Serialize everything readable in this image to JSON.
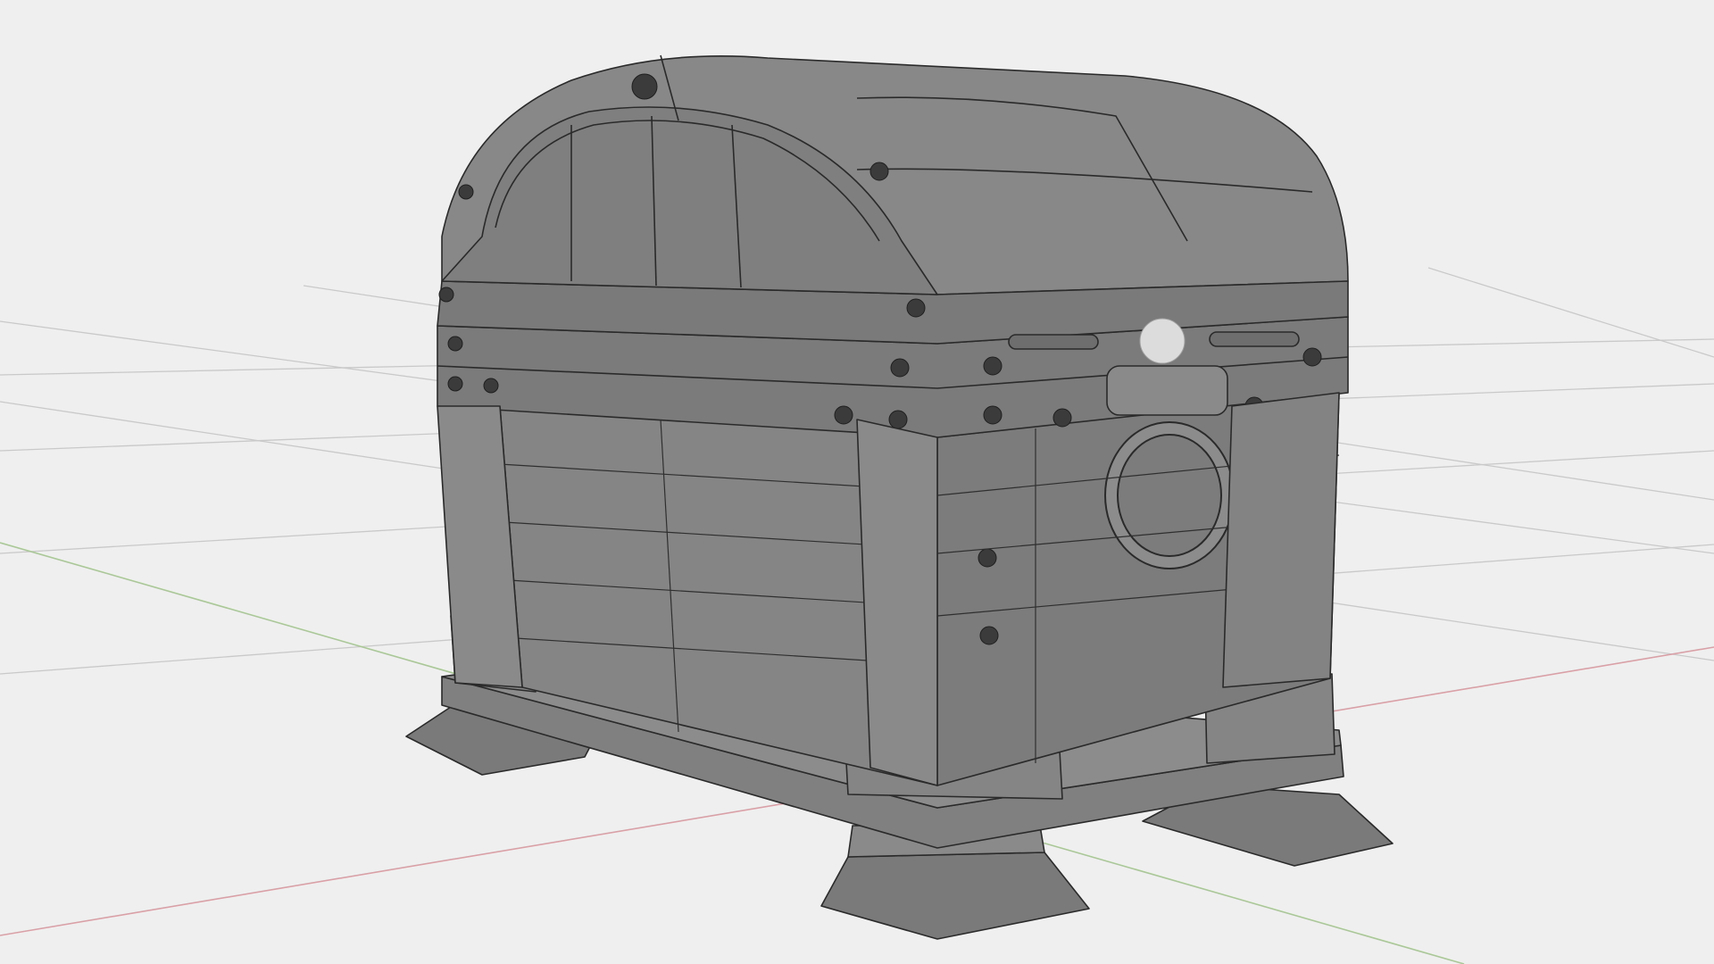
{
  "viewport": {
    "background": "#efefef",
    "grid_color": "#c9c9c9",
    "x_axis_color": "#d9a0a6",
    "y_axis_color": "#a9c896",
    "mesh_color": "#7f7f7f",
    "mesh_shadow": "#6e6e6e",
    "mesh_light": "#8c8c8c",
    "wire_color": "#2a2a2a",
    "light_sphere_color": "#dcdcdc"
  },
  "object": {
    "icon": "treasure-chest-icon",
    "origin_icon": "light-sphere-icon"
  }
}
